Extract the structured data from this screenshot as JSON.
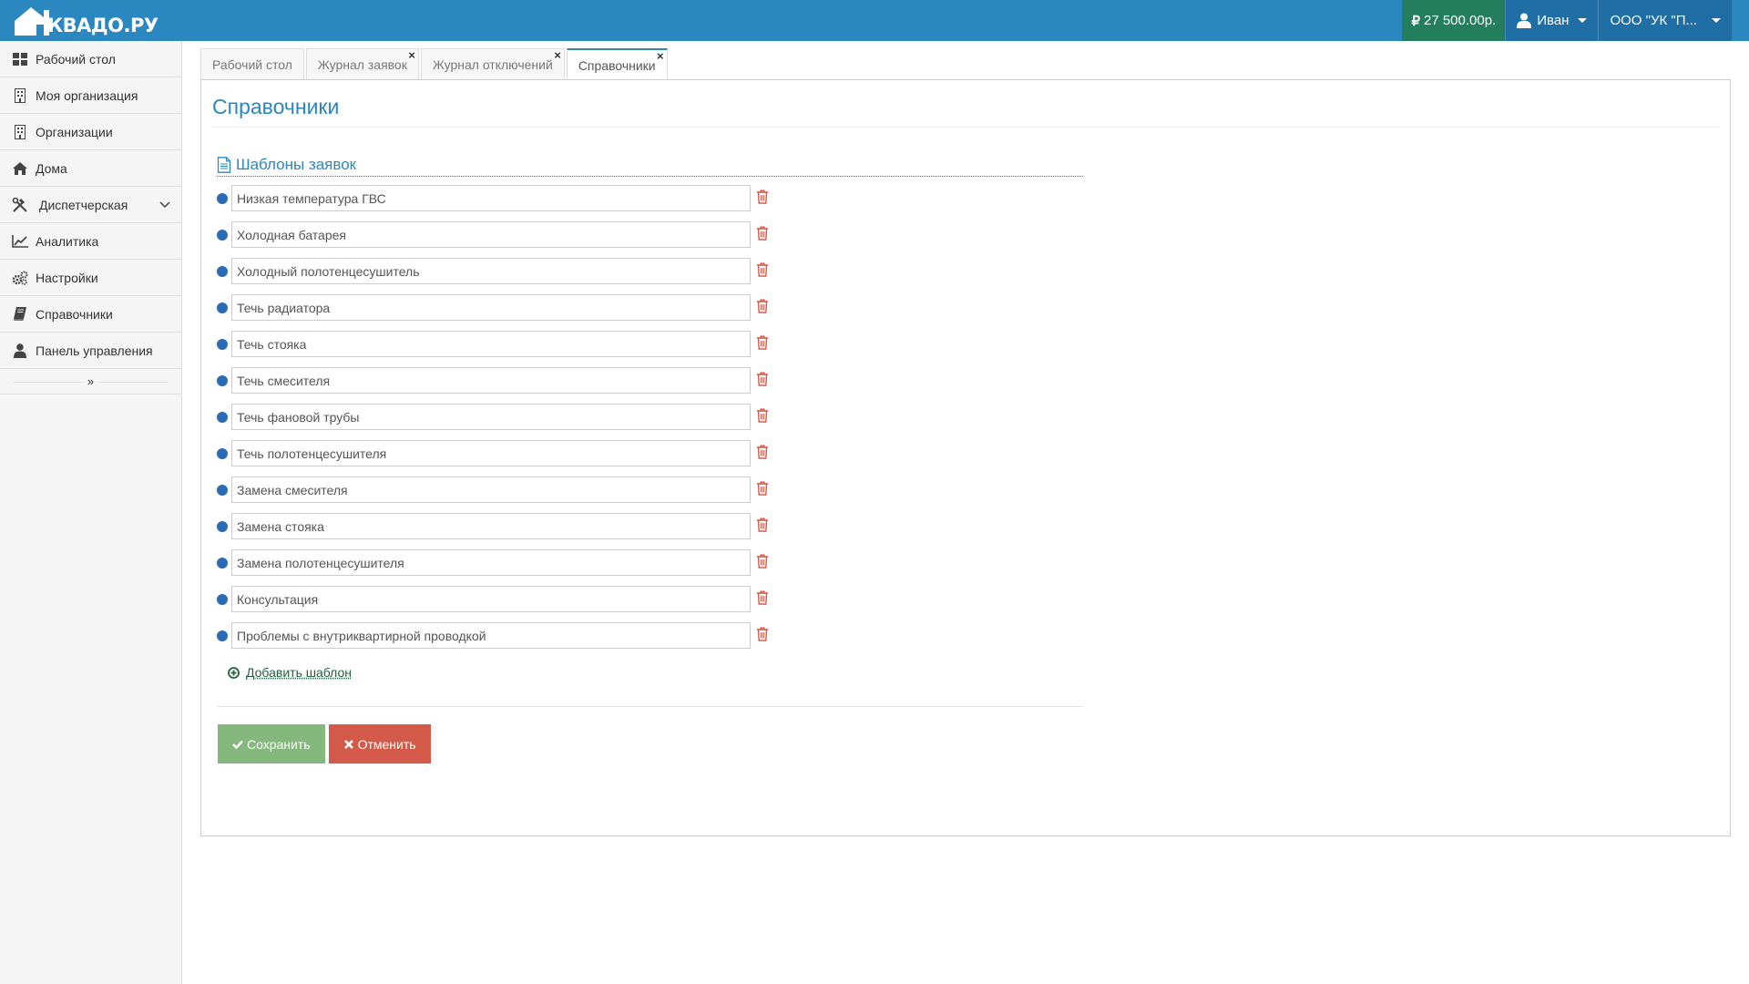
{
  "brand": {
    "name": "КВАДО.РУ"
  },
  "header": {
    "balance": "27 500.00р.",
    "user": "Иван",
    "org": "ООО \"УК \"П..."
  },
  "sidebar": {
    "items": [
      {
        "label": "Рабочий стол"
      },
      {
        "label": "Моя организация"
      },
      {
        "label": "Организации"
      },
      {
        "label": "Дома"
      },
      {
        "label": "Диспетчерская"
      },
      {
        "label": "Аналитика"
      },
      {
        "label": "Настройки"
      },
      {
        "label": "Справочники"
      },
      {
        "label": "Панель управления"
      }
    ],
    "collapse": "»"
  },
  "tabs": [
    {
      "label": "Рабочий стол",
      "closable": false
    },
    {
      "label": "Журнал заявок",
      "closable": true
    },
    {
      "label": "Журнал отключений",
      "closable": true
    },
    {
      "label": "Справочники",
      "closable": true,
      "active": true
    }
  ],
  "tab_close_glyph": "×",
  "page": {
    "title": "Справочники",
    "section_title": "Шаблоны заявок",
    "templates": [
      "Низкая температура ГВС",
      "Холодная батарея",
      "Холодный полотенцесушитель",
      "Течь радиатора",
      "Течь стояка",
      "Течь смесителя",
      "Течь фановой трубы",
      "Течь полотенцесушителя",
      "Замена смесителя",
      "Замена стояка",
      "Замена полотенцесушителя",
      "Консультация",
      "Проблемы с внутриквартирной проводкой"
    ],
    "add_label": "Добавить шаблон",
    "save_label": "Сохранить",
    "cancel_label": "Отменить"
  },
  "colors": {
    "header": "#2a87c0",
    "balance": "#237e5e",
    "accent": "#2a87c0",
    "save": "#84b87c",
    "cancel": "#d35a48",
    "trash": "#d35a48"
  }
}
